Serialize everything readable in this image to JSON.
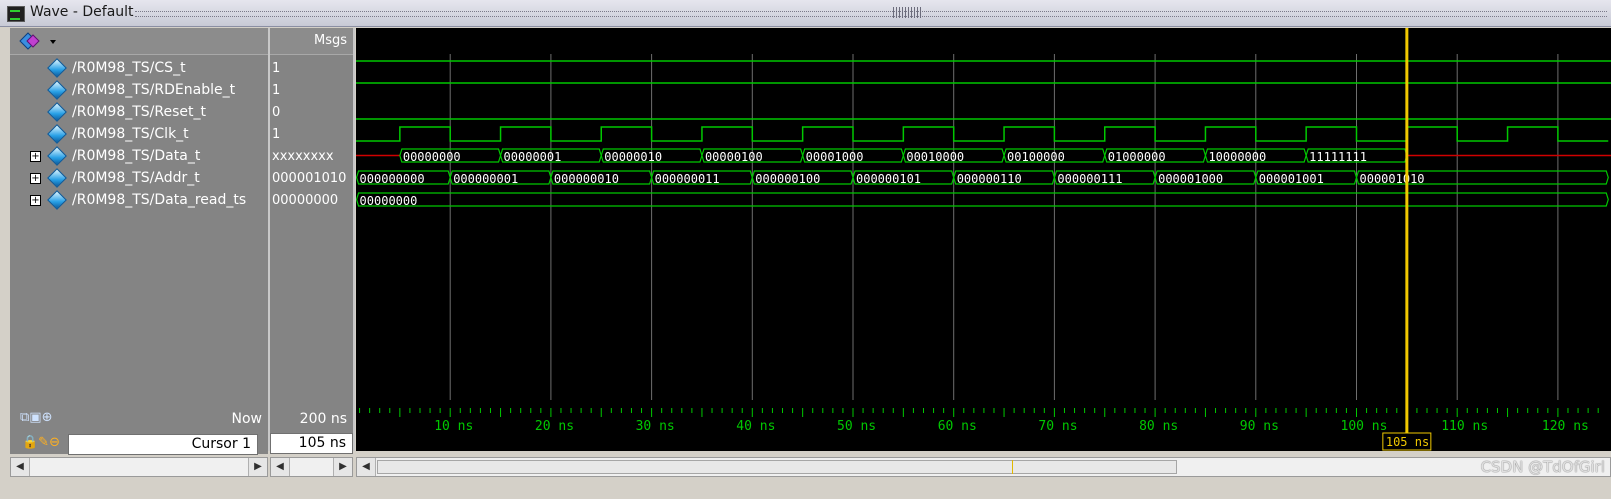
{
  "window": {
    "title": "Wave - Default"
  },
  "header": {
    "msgs_label": "Msgs"
  },
  "signals": [
    {
      "name": "/R0M98_TS/CS_t",
      "value": "1",
      "expandable": false
    },
    {
      "name": "/R0M98_TS/RDEnable_t",
      "value": "1",
      "expandable": false
    },
    {
      "name": "/R0M98_TS/Reset_t",
      "value": "0",
      "expandable": false
    },
    {
      "name": "/R0M98_TS/Clk_t",
      "value": "1",
      "expandable": false
    },
    {
      "name": "/R0M98_TS/Data_t",
      "value": "xxxxxxxx",
      "expandable": true
    },
    {
      "name": "/R0M98_TS/Addr_t",
      "value": "000001010",
      "expandable": true
    },
    {
      "name": "/R0M98_TS/Data_read_ts",
      "value": "00000000",
      "expandable": true
    }
  ],
  "waves": {
    "data_t": [
      "00000000",
      "00000001",
      "00000010",
      "00000100",
      "00001000",
      "00010000",
      "00100000",
      "01000000",
      "10000000",
      "11111111"
    ],
    "addr_t": [
      "000000000",
      "000000001",
      "000000010",
      "000000011",
      "000000100",
      "000000101",
      "000000110",
      "000000111",
      "000001000",
      "000001001",
      "000001010"
    ],
    "data_read_ts": [
      "00000000"
    ]
  },
  "timeline": {
    "ticks": [
      "10 ns",
      "20 ns",
      "30 ns",
      "40 ns",
      "50 ns",
      "60 ns",
      "70 ns",
      "80 ns",
      "90 ns",
      "100 ns",
      "110 ns",
      "120 ns"
    ],
    "now_label": "Now",
    "now_value": "200 ns",
    "cursor_label": "Cursor 1",
    "cursor_value": "105 ns",
    "cursor_marker": "105 ns"
  },
  "colors": {
    "wave": "#00c800",
    "cursor": "#f0c800",
    "undefined": "#d00000",
    "grid": "#6e6e6e"
  },
  "watermark": "CSDN @TdOfGirl"
}
